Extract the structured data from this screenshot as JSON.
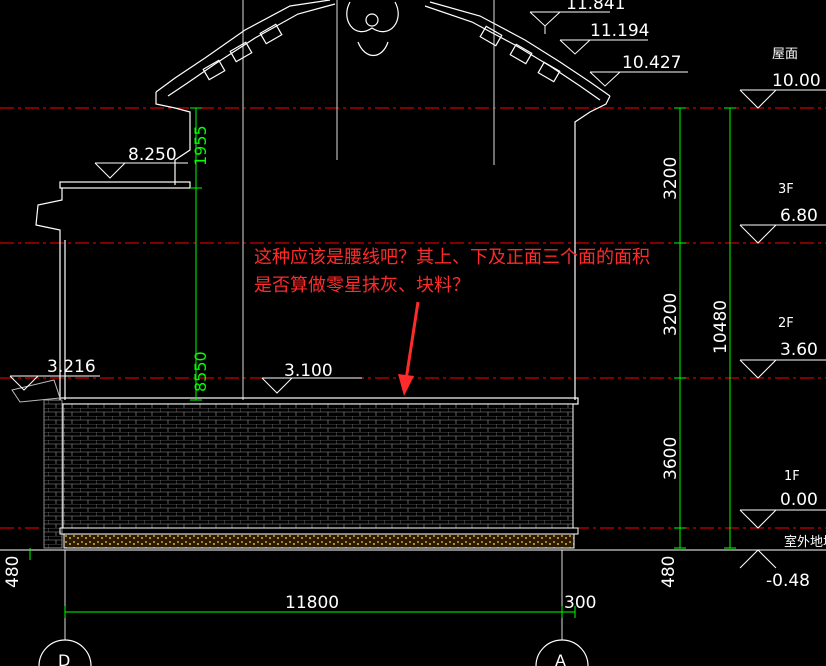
{
  "elevations": {
    "e1": "11.841",
    "e2": "11.194",
    "e3": "10.427",
    "e4": "8.250",
    "e5": "3.216",
    "e6": "3.100"
  },
  "levels": {
    "roof_label": "屋面",
    "roof_value": "10.00",
    "f3_label": "3F",
    "f3_value": "6.80",
    "f2_label": "2F",
    "f2_value": "3.60",
    "f1_label": "1F",
    "f1_value": "0.00",
    "outdoor_label": "室外地坪",
    "outdoor_value": "-0.48"
  },
  "dimensions": {
    "d1955": "1955",
    "d8550": "8550",
    "d3200a": "3200",
    "d3200b": "3200",
    "d3600": "3600",
    "d10480": "10480",
    "d480_left": "480",
    "d480_right": "480",
    "d11800": "11800",
    "d300": "300"
  },
  "axes": {
    "left": "D",
    "right": "A"
  },
  "annotation": {
    "line1": "这种应该是腰线吧？其上、下及正面三个面的面积",
    "line2": "是否算做零星抹灰、块料？"
  },
  "colors": {
    "background": "#000000",
    "drawing": "#ffffff",
    "dimension": "#00ff00",
    "axis": "#ff0000",
    "annotation": "#ff2a2a"
  }
}
